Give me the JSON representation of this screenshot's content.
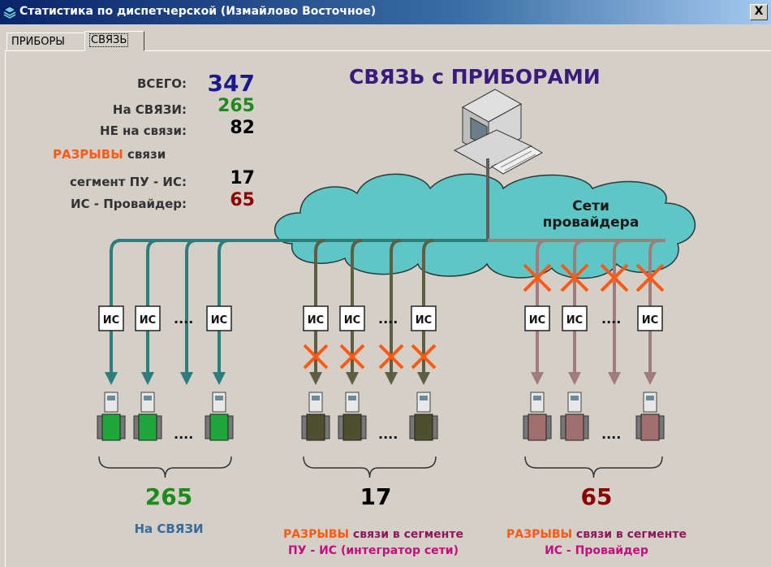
{
  "window": {
    "title": "Статистика по диспетчерской (Измайлово Восточное)",
    "close_label": "X"
  },
  "tabs": [
    {
      "label": "ПРИБОРЫ",
      "active": false
    },
    {
      "label": "СВЯЗЬ",
      "active": true
    }
  ],
  "header": {
    "part1": "СВЯЗЬ с ",
    "part2": "ПРИБОРАМИ"
  },
  "stats": {
    "total_label": "ВСЕГО:",
    "total_value": "347",
    "online_label": "На СВЯЗИ:",
    "online_value": "265",
    "offline_label": "НЕ на связи:",
    "offline_value": "82",
    "breaks_word": "РАЗРЫВЫ",
    "breaks_rest": " связи",
    "seg_pu_label": "сегмент ПУ - ИС:",
    "seg_pu_value": "17",
    "seg_isp_label": "ИС - Провайдер:",
    "seg_isp_value": "65"
  },
  "cloud_label": {
    "line1": "Сети",
    "line2": "провайдера"
  },
  "is_label": "ИС",
  "dots": "....",
  "groups": [
    {
      "count": "265",
      "caption_line1_main": "На СВЯЗИ",
      "caption_line1_rest": "",
      "caption_line2": ""
    },
    {
      "count": "17",
      "caption_line1_main": "РАЗРЫВЫ",
      "caption_line1_rest": " связи в сегменте",
      "caption_line2": "ПУ - ИС (интегратор сети)"
    },
    {
      "count": "65",
      "caption_line1_main": "РАЗРЫВЫ",
      "caption_line1_rest": " связи в сегменте",
      "caption_line2": "ИС - Провайдер"
    }
  ],
  "colors": {
    "title_bar": "#0a246a",
    "total": "#1a1a8c",
    "online": "#1e8a1e",
    "offline": "#000000",
    "breaks": "#ff5a14",
    "seg_isp": "#8b0000",
    "header": "#3a1a7a",
    "cloud": "#5fc6c6",
    "line_online": "#2e7d7d",
    "line_seg": "#5e5e44",
    "line_isp": "#a07c7c"
  }
}
